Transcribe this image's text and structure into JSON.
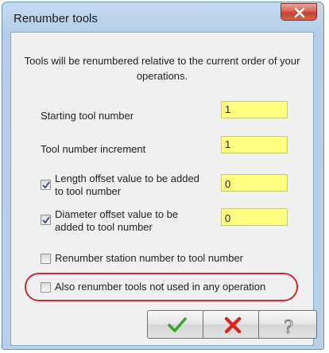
{
  "window": {
    "title": "Renumber tools"
  },
  "intro_text": "Tools will be renumbered relative to the current order of your operations.",
  "fields": {
    "starting": {
      "label": "Starting tool number",
      "value": "1"
    },
    "increment": {
      "label": "Tool number increment",
      "value": "1"
    },
    "length_offset": {
      "label_line1": "Length offset value to be added",
      "label_line2": "to tool number",
      "value": "0",
      "checked": true
    },
    "diameter_offset": {
      "label_line1": "Diameter offset value to be",
      "label_line2": "added to tool number",
      "value": "0",
      "checked": true
    }
  },
  "options": {
    "renumber_station": {
      "label": "Renumber station number to tool number",
      "checked": false
    },
    "renumber_unused": {
      "label": "Also renumber tools not used in any operation",
      "checked": false
    }
  },
  "buttons": {
    "ok_icon": "green-checkmark-icon",
    "cancel_icon": "red-x-icon",
    "help_icon": "question-mark-icon"
  },
  "colors": {
    "input_bg": "#ffff80",
    "highlight": "#cc2b35",
    "ok_green": "#3aa62f",
    "cancel_red": "#d8251d"
  }
}
